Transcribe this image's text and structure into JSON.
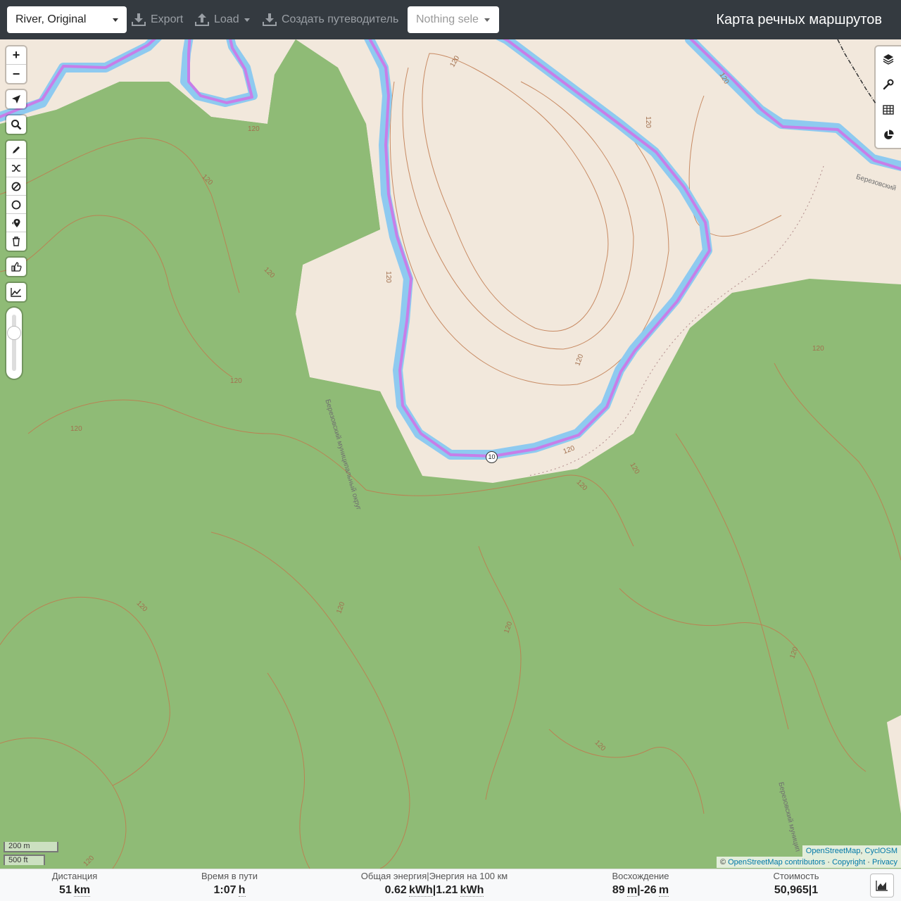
{
  "header": {
    "profile_select": "River, Original",
    "export_label": "Export",
    "load_label": "Load",
    "guide_label": "Создать путеводитель",
    "selection_placeholder": "Nothing sele",
    "brand": "Карта речных маршрутов"
  },
  "map": {
    "route_marker": "10",
    "place_labels": {
      "district_vertical": "Березовский муниципальный округ",
      "district_right": "Березовский",
      "district_bottom_right": "Березовский муницип"
    },
    "contour_labels": [
      "120",
      "120",
      "120",
      "120",
      "120",
      "120",
      "120",
      "120",
      "120",
      "120",
      "120",
      "120",
      "120",
      "120",
      "120",
      "120",
      "120",
      "120",
      "120",
      "120"
    ],
    "scale": {
      "metric": "200 m",
      "imperial": "500 ft"
    },
    "attribution": {
      "tiles_1": "OpenStreetMap",
      "tiles_sep": ", ",
      "tiles_2": "CyclOSM",
      "prefix": "© ",
      "contributors": "OpenStreetMap contributors",
      "sep1": " · ",
      "copyright": "Copyright",
      "sep2": " · ",
      "privacy": "Privacy"
    },
    "icons": [
      "zoom-in-icon",
      "zoom-out-icon",
      "locate-icon",
      "search-icon",
      "draw-icon",
      "reroute-icon",
      "no-go-icon",
      "circle-icon",
      "poi-icon",
      "delete-icon",
      "thumb-icon",
      "elevation-icon",
      "layers-icon",
      "wrench-icon",
      "table-icon",
      "pie-chart-icon"
    ],
    "colors": {
      "forest": "#8fbb76",
      "open_land": "#f2e8dc",
      "water": "#8ecaf0",
      "route": "#c77ee8",
      "contour": "#c07a4e"
    }
  },
  "controls": {
    "zoom_in": "+",
    "zoom_out": "−"
  },
  "stats": {
    "distance": {
      "label": "Дистанция",
      "value": "51",
      "unit": "km"
    },
    "time": {
      "label": "Время в пути",
      "value": "1:07",
      "unit": "h"
    },
    "energy": {
      "label": "Общая энергия|Энергия на 100 км",
      "value1": "0.62",
      "unit1": "kWh",
      "sep": "|",
      "value2": "1.21",
      "unit2": "kWh"
    },
    "ascent": {
      "label": "Восхождение",
      "value1": "89",
      "unit1": "m",
      "sep": "|",
      "value2": "-26",
      "unit2": "m"
    },
    "cost": {
      "label": "Стоимость",
      "value1": "50,965",
      "sep": "|",
      "value2": "1"
    }
  }
}
